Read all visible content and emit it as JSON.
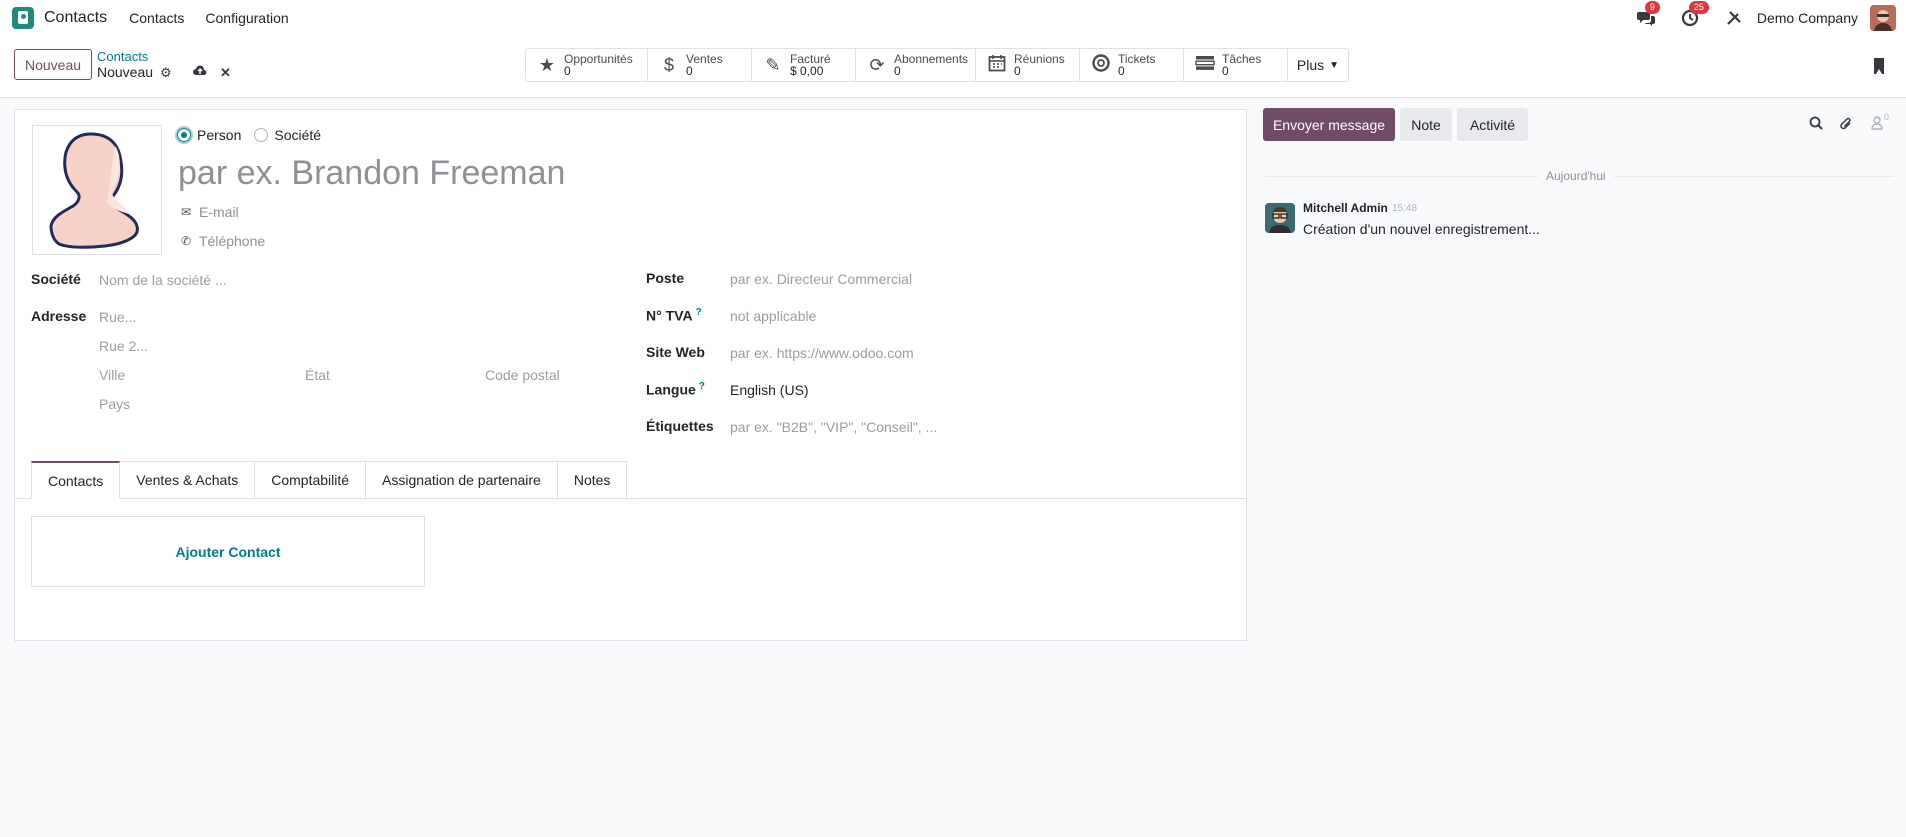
{
  "navbar": {
    "app_name": "Contacts",
    "menus": [
      "Contacts",
      "Configuration"
    ],
    "messages_badge": "9",
    "activities_badge": "25",
    "company": "Demo Company"
  },
  "control_panel": {
    "new_button": "Nouveau",
    "breadcrumb_parent": "Contacts",
    "breadcrumb_current": "Nouveau",
    "smart_buttons": [
      {
        "icon": "star-icon",
        "label": "Opportunités",
        "value": "0"
      },
      {
        "icon": "dollar-icon",
        "label": "Ventes",
        "value": "0"
      },
      {
        "icon": "edit-icon",
        "label": "Facturé",
        "value": "$ 0,00"
      },
      {
        "icon": "refresh-icon",
        "label": "Abonnements",
        "value": "0"
      },
      {
        "icon": "calendar-icon",
        "label": "Réunions",
        "value": "0"
      },
      {
        "icon": "lifebuoy-icon",
        "label": "Tickets",
        "value": "0"
      },
      {
        "icon": "tasks-icon",
        "label": "Tâches",
        "value": "0"
      }
    ],
    "more_button": "Plus"
  },
  "form": {
    "type_person": "Person",
    "type_company": "Société",
    "name_placeholder": "par ex. Brandon Freeman",
    "email_placeholder": "E-mail",
    "phone_placeholder": "Téléphone",
    "company_label": "Société",
    "company_placeholder": "Nom de la société ...",
    "address_label": "Adresse",
    "street_placeholder": "Rue...",
    "street2_placeholder": "Rue 2...",
    "city_placeholder": "Ville",
    "state_placeholder": "État",
    "zip_placeholder": "Code postal",
    "country_placeholder": "Pays",
    "job_label": "Poste",
    "job_placeholder": "par ex. Directeur Commercial",
    "vat_label": "N° TVA",
    "vat_help": "?",
    "vat_placeholder": "not applicable",
    "website_label": "Site Web",
    "website_placeholder": "par ex. https://www.odoo.com",
    "lang_label": "Langue",
    "lang_help": "?",
    "lang_value": "English (US)",
    "tags_label": "Étiquettes",
    "tags_placeholder": "par ex. \"B2B\", \"VIP\", \"Conseil\", ...",
    "tabs": [
      "Contacts",
      "Ventes & Achats",
      "Comptabilité",
      "Assignation de partenaire",
      "Notes"
    ],
    "add_contact": "Ajouter Contact"
  },
  "chatter": {
    "send_message": "Envoyer message",
    "note": "Note",
    "activity": "Activité",
    "followers_count": "0",
    "day_label": "Aujourd'hui",
    "message": {
      "author": "Mitchell Admin",
      "time": "15:48",
      "body": "Création d'un nouvel enregistrement..."
    }
  }
}
